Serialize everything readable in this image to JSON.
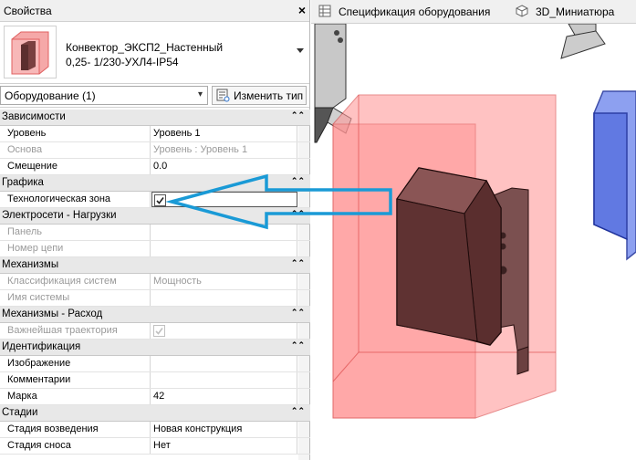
{
  "properties_panel": {
    "title": "Свойства",
    "close_glyph": "×",
    "type_name_line1": "Конвектор_ЭКСП2_Настенный",
    "type_name_line2": "0,25-  1/230-УХЛ4-IP54",
    "filter_value": "Оборудование (1)",
    "edit_type_label": "Изменить тип",
    "collapse_glyph": "⌃⌃"
  },
  "groups": [
    {
      "label": "Зависимости",
      "rows": [
        {
          "label": "Уровень",
          "value": "Уровень 1",
          "disabled": false
        },
        {
          "label": "Основа",
          "value": "Уровень : Уровень 1",
          "disabled": true
        },
        {
          "label": "Смещение",
          "value": "0.0",
          "disabled": false
        }
      ]
    },
    {
      "label": "Графика",
      "rows": [
        {
          "label": "Технологическая зона",
          "value": "",
          "checkbox": true,
          "checked": true,
          "selected": true,
          "disabled": false
        }
      ]
    },
    {
      "label": "Электросети - Нагрузки",
      "rows": [
        {
          "label": "Панель",
          "value": "",
          "disabled": true
        },
        {
          "label": "Номер цепи",
          "value": "",
          "disabled": true
        }
      ]
    },
    {
      "label": "Механизмы",
      "rows": [
        {
          "label": "Классификация систем",
          "value": "Мощность",
          "disabled": true
        },
        {
          "label": "Имя системы",
          "value": "",
          "disabled": true
        }
      ]
    },
    {
      "label": "Механизмы - Расход",
      "rows": [
        {
          "label": "Важнейшая траектория",
          "value": "",
          "checkbox": true,
          "checked": true,
          "disabled": true
        }
      ]
    },
    {
      "label": "Идентификация",
      "rows": [
        {
          "label": "Изображение",
          "value": "",
          "disabled": false
        },
        {
          "label": "Комментарии",
          "value": "",
          "disabled": false
        },
        {
          "label": "Марка",
          "value": "42",
          "disabled": false
        }
      ]
    },
    {
      "label": "Стадии",
      "rows": [
        {
          "label": "Стадия возведения",
          "value": "Новая конструкция",
          "disabled": false
        },
        {
          "label": "Стадия сноса",
          "value": "Нет",
          "disabled": false
        }
      ]
    }
  ],
  "tabs": [
    {
      "label": "Спецификация оборудования",
      "icon": "schedule-icon"
    },
    {
      "label": "3D_Миниатюра",
      "icon": "3d-view-icon"
    }
  ],
  "colors": {
    "accent_arrow": "#1a9ad6",
    "zone_fill": "#ff8080",
    "device_body": "#6b3a3a",
    "neighbor_blue": "#3a55c8"
  }
}
